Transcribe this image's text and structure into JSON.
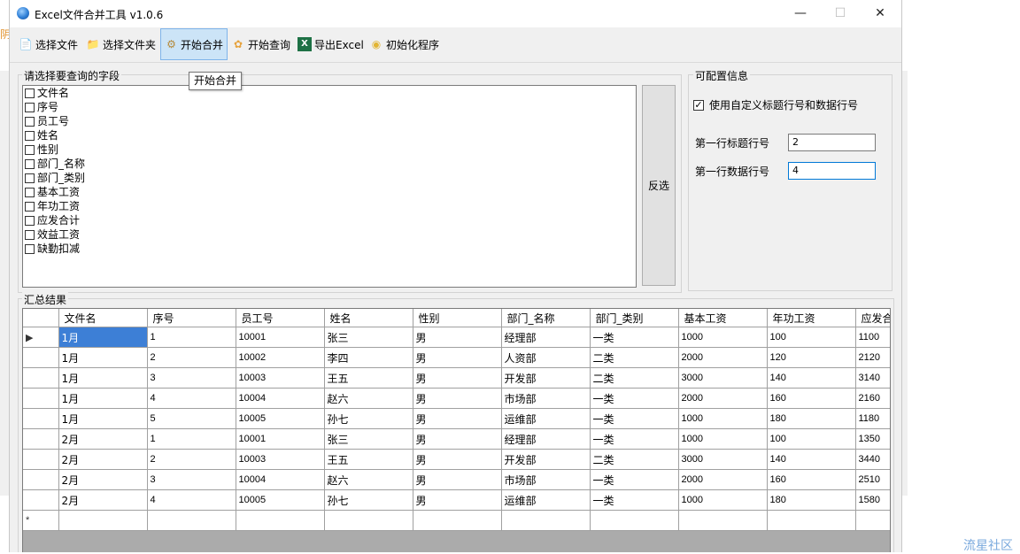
{
  "window": {
    "title": "Excel文件合并工具 v1.0.6",
    "controls": {
      "minimize": "—",
      "maximize": "☐",
      "close": "✕"
    }
  },
  "toolbar": {
    "items": [
      {
        "label": "选择文件",
        "icon": "file-icon",
        "glyph": "📄"
      },
      {
        "label": "选择文件夹",
        "icon": "folder-icon",
        "glyph": "📁"
      },
      {
        "label": "开始合并",
        "icon": "merge-icon",
        "glyph": "⚙"
      },
      {
        "label": "开始查询",
        "icon": "query-icon",
        "glyph": "✿"
      },
      {
        "label": "导出Excel",
        "icon": "excel-icon",
        "glyph": "X"
      },
      {
        "label": "初始化程序",
        "icon": "init-icon",
        "glyph": "◉"
      }
    ]
  },
  "tooltip": "开始合并",
  "fields_group": {
    "title": "请选择要查询的字段",
    "items": [
      "文件名",
      "序号",
      "员工号",
      "姓名",
      "性别",
      "部门_名称",
      "部门_类别",
      "基本工资",
      "年功工资",
      "应发合计",
      "效益工资",
      "缺勤扣减"
    ],
    "invert_button": "反选"
  },
  "config_group": {
    "title": "可配置信息",
    "custom_rows_checkbox": {
      "label": "使用自定义标题行号和数据行号",
      "checked": true,
      "mark": "✓"
    },
    "header_row": {
      "label": "第一行标题行号",
      "value": "2"
    },
    "data_row": {
      "label": "第一行数据行号",
      "value": "4"
    }
  },
  "results_group": {
    "title": "汇总结果",
    "columns": [
      "文件名",
      "序号",
      "员工号",
      "姓名",
      "性别",
      "部门_名称",
      "部门_类别",
      "基本工资",
      "年功工资",
      "应发合"
    ],
    "current_row_marker": "▶",
    "new_row_marker": "*",
    "rows": [
      [
        "1月",
        "1",
        "10001",
        "张三",
        "男",
        "经理部",
        "一类",
        "1000",
        "100",
        "1100"
      ],
      [
        "1月",
        "2",
        "10002",
        "李四",
        "男",
        "人资部",
        "二类",
        "2000",
        "120",
        "2120"
      ],
      [
        "1月",
        "3",
        "10003",
        "王五",
        "男",
        "开发部",
        "二类",
        "3000",
        "140",
        "3140"
      ],
      [
        "1月",
        "4",
        "10004",
        "赵六",
        "男",
        "市场部",
        "一类",
        "2000",
        "160",
        "2160"
      ],
      [
        "1月",
        "5",
        "10005",
        "孙七",
        "男",
        "运维部",
        "一类",
        "1000",
        "180",
        "1180"
      ],
      [
        "2月",
        "1",
        "10001",
        "张三",
        "男",
        "经理部",
        "一类",
        "1000",
        "100",
        "1350"
      ],
      [
        "2月",
        "2",
        "10003",
        "王五",
        "男",
        "开发部",
        "二类",
        "3000",
        "140",
        "3440"
      ],
      [
        "2月",
        "3",
        "10004",
        "赵六",
        "男",
        "市场部",
        "一类",
        "2000",
        "160",
        "2510"
      ],
      [
        "2月",
        "4",
        "10005",
        "孙七",
        "男",
        "运维部",
        "一类",
        "1000",
        "180",
        "1580"
      ]
    ]
  },
  "watermark": "流星社区",
  "colors": {
    "selection": "#3d7fd6",
    "active_button_bg": "#cce4f7",
    "window_bg": "#f0f0f0",
    "watermark": "#7aa9dd"
  }
}
